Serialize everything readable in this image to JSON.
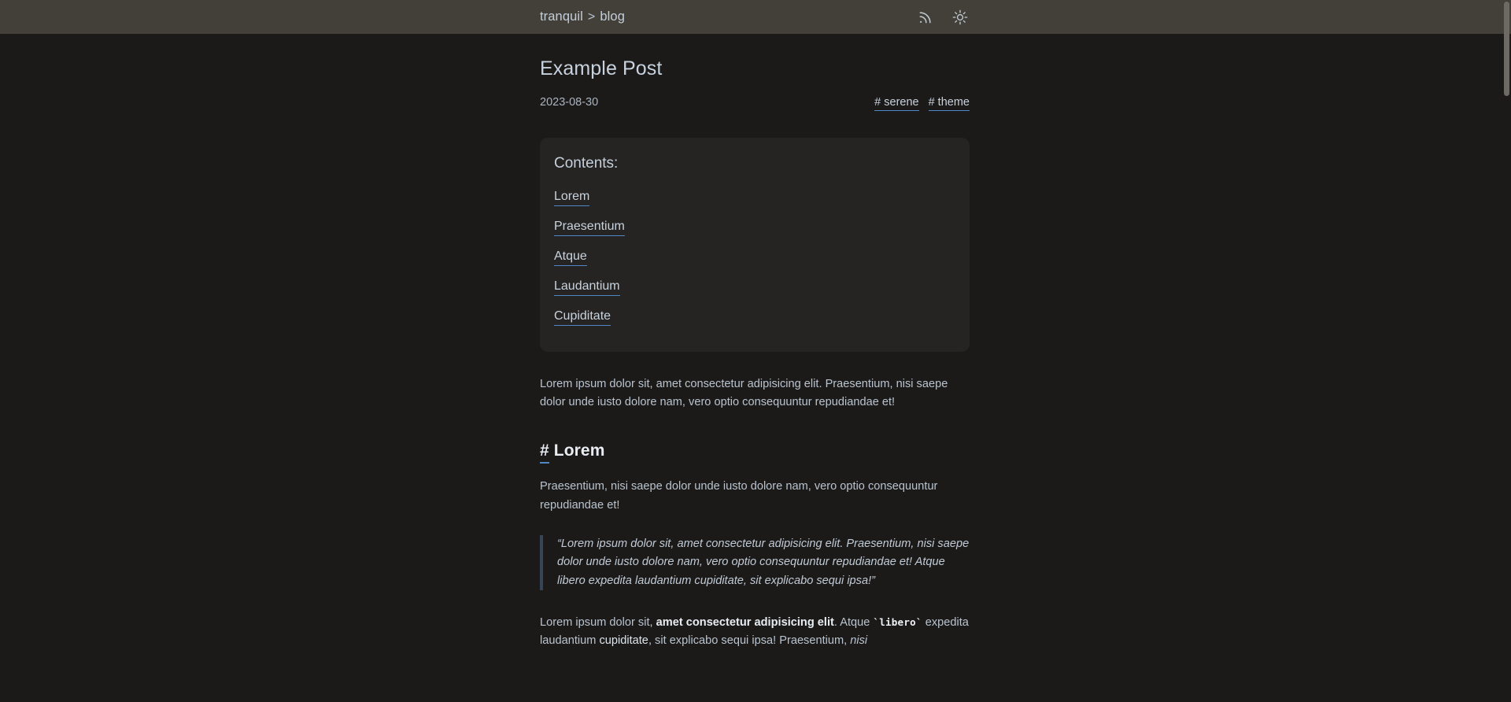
{
  "topbar": {
    "breadcrumb": {
      "site": "tranquil",
      "separator": ">",
      "section": "blog"
    },
    "icons": {
      "rss": "rss-feed-icon",
      "theme": "sun-light-mode-icon"
    }
  },
  "post": {
    "title": "Example Post",
    "date": "2023-08-30",
    "tags": [
      {
        "label": "# serene"
      },
      {
        "label": "# theme"
      }
    ],
    "toc": {
      "title": "Contents:",
      "items": [
        {
          "label": "Lorem"
        },
        {
          "label": "Praesentium"
        },
        {
          "label": "Atque"
        },
        {
          "label": "Laudantium"
        },
        {
          "label": "Cupiditate"
        }
      ]
    },
    "intro": "Lorem ipsum dolor sit, amet consectetur adipisicing elit. Praesentium, nisi saepe dolor unde iusto dolore nam, vero optio consequuntur repudiandae et!",
    "sections": [
      {
        "hash": "#",
        "heading": "Lorem",
        "paragraph": "Praesentium, nisi saepe dolor unde iusto dolore nam, vero optio consequuntur repudiandae et!",
        "quote": "“Lorem ipsum dolor sit, amet consectetur adipisicing elit. Praesentium, nisi saepe dolor unde iusto dolore nam, vero optio consequuntur repudiandae et! Atque libero expedita laudantium cupiditate, sit explicabo sequi ipsa!”",
        "rich_paragraph": {
          "lead": "Lorem ipsum dolor sit, ",
          "bold": "amet consectetur adipisicing elit",
          "mid": ". Atque ",
          "code": "`libero`",
          "after_code": " expedita laudantium ",
          "link": "cupiditate",
          "tail": ", sit explicabo sequi ipsa! Praesentium, ",
          "italic": "nisi"
        }
      }
    ]
  },
  "colors": {
    "topbar_bg": "#434039",
    "page_bg": "#1c1a18",
    "toc_bg": "#262422",
    "accent_underline": "#4f87c4",
    "quote_border": "#36445a",
    "body_text": "#b9c4d0",
    "heading_text": "#e8edf3",
    "scrollbar_thumb": "#6e6a63"
  }
}
